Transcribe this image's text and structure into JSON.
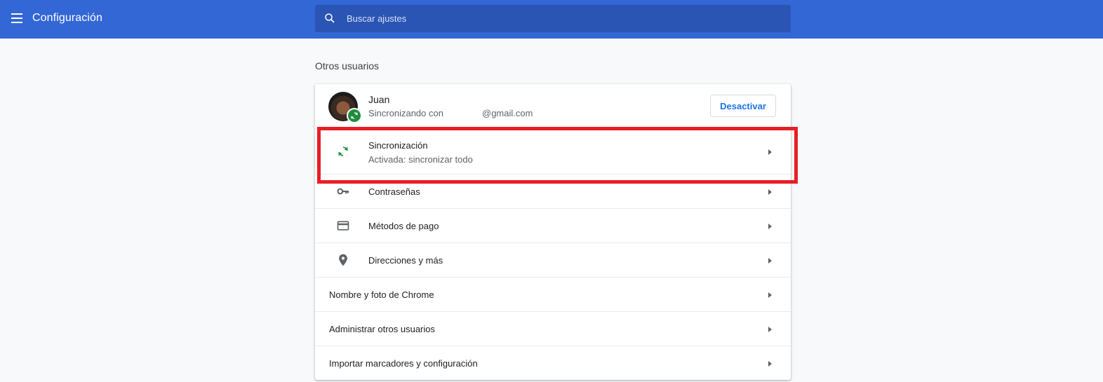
{
  "header": {
    "title": "Configuración",
    "menu_icon": "hamburger-menu-icon",
    "search": {
      "placeholder": "Buscar ajustes",
      "value": "",
      "icon": "search-icon"
    }
  },
  "section": {
    "title": "Otros usuarios"
  },
  "profile": {
    "name": "Juan",
    "sync_prefix": "Sincronizando con",
    "sync_email": "@gmail.com",
    "disable_label": "Desactivar",
    "badge_icon": "sync-icon"
  },
  "rows": [
    {
      "label": "Sincronización",
      "sub": "Activada: sincronizar todo",
      "icon": "sync-icon"
    },
    {
      "label": "Contraseñas",
      "icon": "key-icon"
    },
    {
      "label": "Métodos de pago",
      "icon": "credit-card-icon"
    },
    {
      "label": "Direcciones y más",
      "icon": "location-pin-icon"
    },
    {
      "label": "Nombre y foto de Chrome"
    },
    {
      "label": "Administrar otros usuarios"
    },
    {
      "label": "Importar marcadores y configuración"
    }
  ],
  "colors": {
    "header_bg": "#3367d6",
    "search_bg": "#2a55b5",
    "accent": "#1a73e8",
    "sync_green": "#1e8e3e",
    "highlight_red": "#e81e25"
  }
}
